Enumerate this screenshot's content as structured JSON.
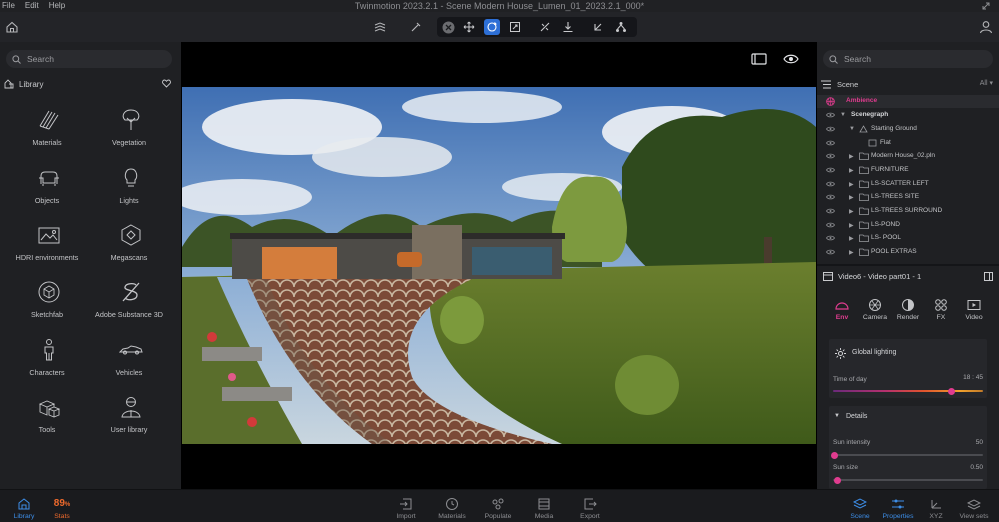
{
  "app": {
    "menu": [
      "File",
      "Edit",
      "Help"
    ],
    "title": "Twinmotion 2023.2.1 - Scene Modern House_Lumen_01_2023.2.1_000*"
  },
  "left_panel": {
    "search_placeholder": "Search",
    "library_title": "Library",
    "tiles": [
      {
        "label": "Materials",
        "icon": "materials-icon"
      },
      {
        "label": "Vegetation",
        "icon": "vegetation-icon"
      },
      {
        "label": "Objects",
        "icon": "objects-icon"
      },
      {
        "label": "Lights",
        "icon": "lights-icon"
      },
      {
        "label": "HDRI environments",
        "icon": "hdri-icon"
      },
      {
        "label": "Megascans",
        "icon": "megascans-icon"
      },
      {
        "label": "Sketchfab",
        "icon": "sketchfab-icon"
      },
      {
        "label": "Adobe Substance 3D",
        "icon": "substance-icon"
      },
      {
        "label": "Characters",
        "icon": "characters-icon"
      },
      {
        "label": "Vehicles",
        "icon": "vehicles-icon"
      },
      {
        "label": "Tools",
        "icon": "tools-icon"
      },
      {
        "label": "User library",
        "icon": "user-library-icon"
      }
    ]
  },
  "right_panel": {
    "search_placeholder": "Search",
    "scene_title": "Scene",
    "scene_filter": "All",
    "tree": [
      {
        "name": "Ambience",
        "level": 0,
        "kind": "ambience"
      },
      {
        "name": "Scenegraph",
        "level": 0,
        "kind": "group"
      },
      {
        "name": "Starting Ground",
        "level": 1,
        "kind": "ground"
      },
      {
        "name": "Flat",
        "level": 2,
        "kind": "layer"
      },
      {
        "name": "Modern House_02.pln",
        "level": 1,
        "kind": "folder"
      },
      {
        "name": "FURNITURE",
        "level": 1,
        "kind": "folder"
      },
      {
        "name": "LS-SCATTER LEFT",
        "level": 1,
        "kind": "folder"
      },
      {
        "name": "LS-TREES SITE",
        "level": 1,
        "kind": "folder"
      },
      {
        "name": "LS-TREES SURROUND",
        "level": 1,
        "kind": "folder"
      },
      {
        "name": "LS-POND",
        "level": 1,
        "kind": "folder"
      },
      {
        "name": "LS- POOL",
        "level": 1,
        "kind": "folder"
      },
      {
        "name": "POOL EXTRAS",
        "level": 1,
        "kind": "folder"
      }
    ],
    "properties_title": "Video6 - Video part01 - 1",
    "tabs": [
      "Env",
      "Camera",
      "Render",
      "FX",
      "Video"
    ],
    "active_tab": "Env",
    "global_lighting": "Global lighting",
    "time_of_day_label": "Time of day",
    "time_of_day_value": "18 : 45",
    "time_of_day_fraction": 0.78,
    "details_label": "Details",
    "sun_intensity_label": "Sun intensity",
    "sun_intensity_value": "50",
    "sun_intensity_fraction": 0.0,
    "sun_size_label": "Sun size",
    "sun_size_value": "0.50",
    "sun_size_fraction": 0.02
  },
  "bottom_bar": {
    "library": "Library",
    "stats_value": "89",
    "stats_unit": "%",
    "stats": "Stats",
    "import": "Import",
    "materials": "Materials",
    "populate": "Populate",
    "media": "Media",
    "export": "Export",
    "scene": "Scene",
    "properties": "Properties",
    "xyz": "XYZ",
    "view_sets": "View sets"
  },
  "colors": {
    "accent_pink": "#e03c8f",
    "accent_blue": "#3d8ee8",
    "stats_orange": "#ef6a2c",
    "active_tool": "#2d6fd6"
  }
}
